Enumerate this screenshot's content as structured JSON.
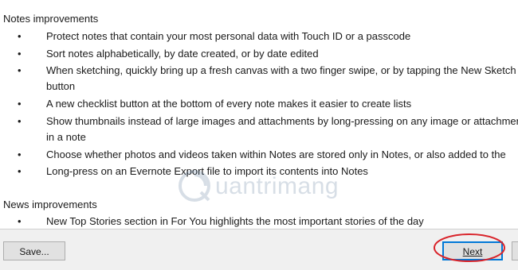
{
  "notes": {
    "title": "Notes improvements",
    "items": [
      {
        "line1": "Protect notes that contain your most personal data with Touch ID or a passcode"
      },
      {
        "line1": "Sort notes alphabetically, by date created, or by date edited"
      },
      {
        "line1": "When sketching, quickly bring up a fresh canvas with a two finger swipe, or by tapping the New Sketch",
        "line2": "button"
      },
      {
        "line1": "A new checklist button at the bottom of every note makes it easier to create lists"
      },
      {
        "line1": "Show thumbnails instead of large images and attachments by long-pressing on any image or attachment",
        "line2": "in a note"
      },
      {
        "line1": "Choose whether photos and videos taken within Notes are stored only in Notes, or also added to the"
      },
      {
        "line1": "Long-press on an Evernote Export file to import its contents into Notes"
      }
    ]
  },
  "news": {
    "title": "News improvements",
    "items": [
      {
        "line1": "New Top Stories section in For You highlights the most important stories of the day"
      }
    ]
  },
  "bullet_char": "•",
  "watermark": {
    "text": "uantrimang"
  },
  "buttons": {
    "save_label": "Save...",
    "next_label": "Next"
  },
  "colors": {
    "highlight_ellipse": "#d9232a",
    "focus_border": "#0078d7"
  }
}
